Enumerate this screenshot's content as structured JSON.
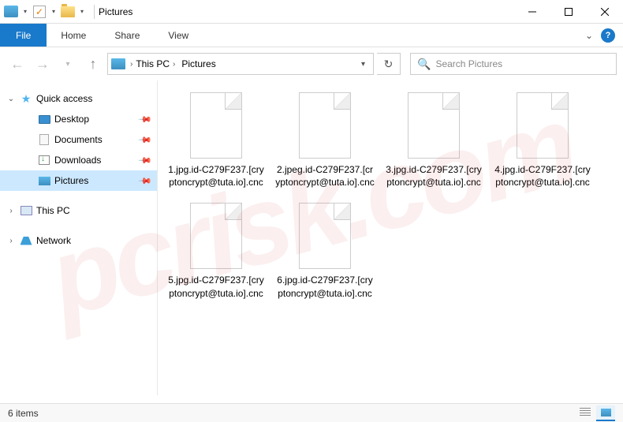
{
  "titlebar": {
    "title": "Pictures"
  },
  "ribbon": {
    "file": "File",
    "tabs": [
      "Home",
      "Share",
      "View"
    ]
  },
  "breadcrumb": {
    "segments": [
      "This PC",
      "Pictures"
    ]
  },
  "search": {
    "placeholder": "Search Pictures"
  },
  "sidebar": {
    "quick_access": {
      "label": "Quick access",
      "items": [
        {
          "label": "Desktop",
          "icon": "monitor"
        },
        {
          "label": "Documents",
          "icon": "doc"
        },
        {
          "label": "Downloads",
          "icon": "downl"
        },
        {
          "label": "Pictures",
          "icon": "pic",
          "selected": true
        }
      ]
    },
    "this_pc": {
      "label": "This PC"
    },
    "network": {
      "label": "Network"
    }
  },
  "files": [
    {
      "name": "1.jpg.id-C279F237.[cryptoncrypt@tuta.io].cnc"
    },
    {
      "name": "2.jpeg.id-C279F237.[cryptoncrypt@tuta.io].cnc"
    },
    {
      "name": "3.jpg.id-C279F237.[cryptoncrypt@tuta.io].cnc"
    },
    {
      "name": "4.jpg.id-C279F237.[cryptoncrypt@tuta.io].cnc"
    },
    {
      "name": "5.jpg.id-C279F237.[cryptoncrypt@tuta.io].cnc"
    },
    {
      "name": "6.jpg.id-C279F237.[cryptoncrypt@tuta.io].cnc"
    }
  ],
  "statusbar": {
    "count": "6 items"
  },
  "watermark": "pcrisk.com"
}
